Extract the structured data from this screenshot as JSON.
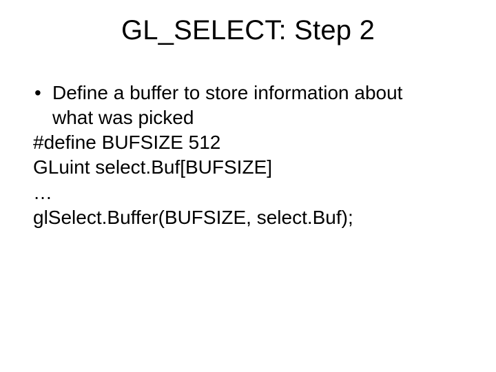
{
  "slide": {
    "title": "GL_SELECT: Step 2",
    "bullet_line1": "Define a buffer to store information about",
    "bullet_line2": "what was picked",
    "code_line1": "#define BUFSIZE 512",
    "code_line2": "GLuint select.Buf[BUFSIZE]",
    "code_line3": "…",
    "code_line4": "glSelect.Buffer(BUFSIZE, select.Buf);"
  }
}
